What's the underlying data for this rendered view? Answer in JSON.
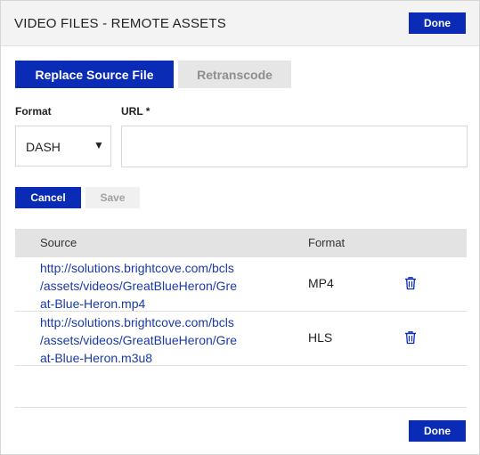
{
  "header": {
    "title": "VIDEO FILES - REMOTE ASSETS",
    "done_label": "Done"
  },
  "tabs": {
    "replace_label": "Replace Source File",
    "retranscode_label": "Retranscode"
  },
  "form": {
    "format_label": "Format",
    "format_value": "DASH",
    "format_caret": "▼",
    "url_label": "URL *",
    "url_value": "",
    "cancel_label": "Cancel",
    "save_label": "Save"
  },
  "table": {
    "columns": [
      "Source",
      "Format"
    ],
    "rows": [
      {
        "source_lines": [
          "http://solutions.brightcove.com/bcls",
          "/assets/videos/GreatBlueHeron/Gre",
          "at-Blue-Heron.mp4"
        ],
        "format": "MP4",
        "action_icon": "trash-icon"
      },
      {
        "source_lines": [
          "http://solutions.brightcove.com/bcls",
          "/assets/videos/GreatBlueHeron/Gre",
          "at-Blue-Heron.m3u8"
        ],
        "format": "HLS",
        "action_icon": "trash-icon"
      }
    ]
  },
  "footer": {
    "done_label": "Done"
  },
  "colors": {
    "primary": "#0a2bb5",
    "link": "#1a3aa8",
    "header_bg": "#f3f3f3",
    "table_header_bg": "#e3e3e3"
  }
}
